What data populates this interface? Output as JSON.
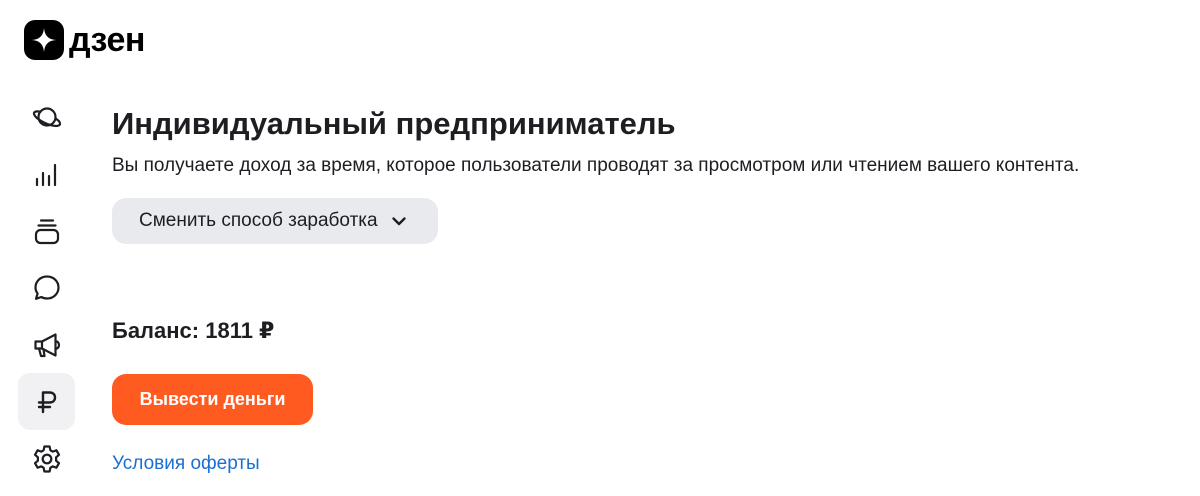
{
  "header": {
    "logo_text": "дзен",
    "logo_icon": "zen-star-icon"
  },
  "sidebar": {
    "items": [
      {
        "icon": "planet-icon",
        "active": false
      },
      {
        "icon": "bar-chart-icon",
        "active": false
      },
      {
        "icon": "stacked-cards-icon",
        "active": false
      },
      {
        "icon": "chat-bubble-icon",
        "active": false
      },
      {
        "icon": "megaphone-icon",
        "active": false
      },
      {
        "icon": "ruble-icon",
        "active": true
      },
      {
        "icon": "gear-icon",
        "active": false
      }
    ]
  },
  "main": {
    "title": "Индивидуальный предприниматель",
    "subtitle": "Вы получаете доход за время, которое пользователи проводят за просмотром или чтением вашего контента.",
    "switch_button_label": "Сменить способ заработка",
    "balance": "Баланс: 1811 ₽",
    "withdraw_button_label": "Вывести деньги",
    "offer_link_label": "Условия оферты"
  },
  "colors": {
    "accent": "#ff5a1f",
    "link": "#1a6fd0",
    "button_secondary_bg": "#e9eaed",
    "active_nav_bg": "#f1f1f3"
  }
}
